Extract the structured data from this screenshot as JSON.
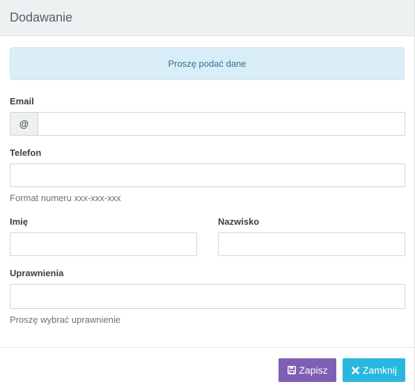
{
  "header": {
    "title": "Dodawanie"
  },
  "alert": {
    "text": "Proszę podać dane"
  },
  "form": {
    "email": {
      "label": "Email",
      "addon": "@",
      "value": ""
    },
    "phone": {
      "label": "Telefon",
      "value": "",
      "help": "Format numeru xxx-xxx-xxx"
    },
    "first_name": {
      "label": "Imię",
      "value": ""
    },
    "last_name": {
      "label": "Nazwisko",
      "value": ""
    },
    "permissions": {
      "label": "Uprawnienia",
      "value": "",
      "help": "Proszę wybrać uprawnienie"
    }
  },
  "footer": {
    "save_label": "Zapisz",
    "close_label": "Zamknij",
    "save_color": "#7e5fb3",
    "close_color": "#2ab7df",
    "save_icon": "floppy-disk-icon",
    "close_icon": "close-x-icon"
  }
}
